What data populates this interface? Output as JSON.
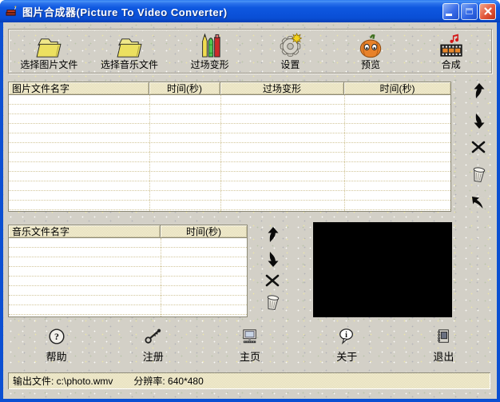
{
  "window": {
    "title": "图片合成器(Picture To Video Converter)",
    "controls": {
      "minimize_icon": "minimize-icon",
      "maximize_icon": "maximize-icon",
      "close_icon": "close-icon"
    }
  },
  "toolbar": {
    "items": [
      {
        "label": "选择图片文件",
        "icon": "folder-icon"
      },
      {
        "label": "选择音乐文件",
        "icon": "folder-icon"
      },
      {
        "label": "过场变形",
        "icon": "pencils-icon"
      },
      {
        "label": "设置",
        "icon": "gear-icon"
      },
      {
        "label": "预览",
        "icon": "pumpkin-icon"
      },
      {
        "label": "合成",
        "icon": "film-music-icon"
      }
    ]
  },
  "picture_table": {
    "columns": [
      "图片文件名字",
      "时间(秒)",
      "过场变形",
      "时间(秒)"
    ],
    "rows": []
  },
  "music_table": {
    "columns": [
      "音乐文件名字",
      "时间(秒)"
    ],
    "rows": []
  },
  "list_actions": {
    "picture": [
      "move-up",
      "move-down",
      "delete",
      "clear-all",
      "edit-item"
    ],
    "music": [
      "move-up",
      "move-down",
      "delete",
      "clear-all"
    ]
  },
  "preview": {
    "state": "empty-black"
  },
  "bottom_nav": {
    "items": [
      {
        "label": "帮助",
        "icon": "help-icon"
      },
      {
        "label": "注册",
        "icon": "key-icon"
      },
      {
        "label": "主页",
        "icon": "monitor-icon"
      },
      {
        "label": "关于",
        "icon": "info-bubble-icon"
      },
      {
        "label": "退出",
        "icon": "notebook-icon"
      }
    ]
  },
  "status_bar": {
    "output": "输出文件: c:\\photo.wmv",
    "resolution": "分辨率: 640*480"
  },
  "colors": {
    "titlebar_blue": "#0b52da",
    "close_red": "#e2573a",
    "client_gray": "#d3d0c7",
    "header_cream": "#ebe5c2",
    "folder_yellow": "#ece060",
    "pumpkin_orange": "#e8822a",
    "note_red": "#d41818",
    "preview_black": "#000000"
  }
}
